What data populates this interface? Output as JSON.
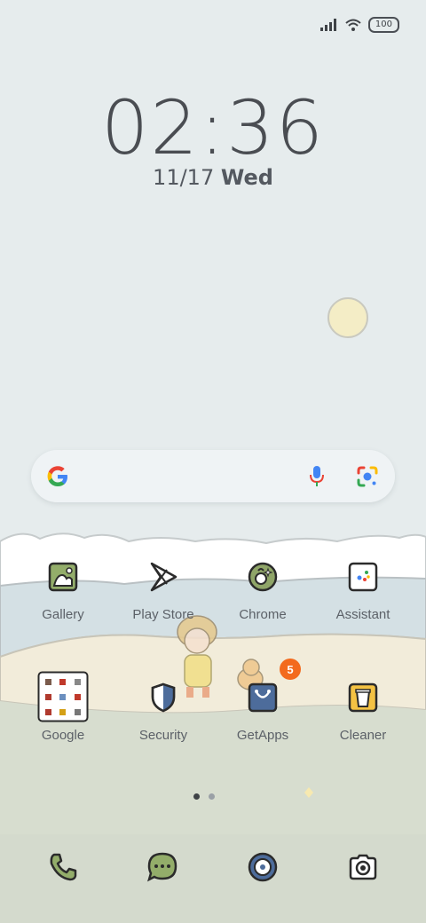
{
  "status_bar": {
    "battery": "100",
    "signal_icon": "signal-icon",
    "wifi_icon": "wifi-icon"
  },
  "clock": {
    "time": "02:36",
    "date": "11/17",
    "weekday": "Wed"
  },
  "search_bar": {
    "google_icon": "google-g-icon",
    "mic_icon": "mic-icon",
    "lens_icon": "lens-icon"
  },
  "apps_row1": [
    {
      "label": "Gallery",
      "icon": "gallery-icon"
    },
    {
      "label": "Play Store",
      "icon": "play-store-icon"
    },
    {
      "label": "Chrome",
      "icon": "chrome-icon"
    },
    {
      "label": "Assistant",
      "icon": "assistant-icon"
    }
  ],
  "apps_row2": [
    {
      "label": "Google",
      "icon": "google-folder-icon"
    },
    {
      "label": "Security",
      "icon": "security-icon"
    },
    {
      "label": "GetApps",
      "icon": "getapps-icon",
      "badge": "5"
    },
    {
      "label": "Cleaner",
      "icon": "cleaner-icon"
    }
  ],
  "page_indicator": {
    "pages": 2,
    "active": 1
  },
  "dock": [
    {
      "icon": "phone-icon"
    },
    {
      "icon": "messages-icon"
    },
    {
      "icon": "music-icon"
    },
    {
      "icon": "camera-icon"
    }
  ],
  "colors": {
    "sky": "#e6eced",
    "sea": "#d9e4e7",
    "sand": "#f1ecdc",
    "grass": "#d7ddcf",
    "sun": "#f4edc6",
    "badge": "#f36a1d"
  }
}
